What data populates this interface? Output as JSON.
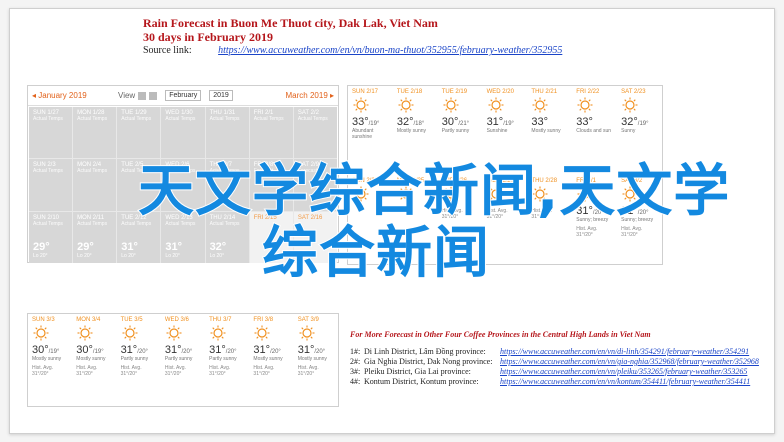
{
  "header": {
    "title": "Rain Forecast in Buon Me Thuot city, Dak Lak, Viet Nam",
    "subtitle": "30 days in February 2019",
    "source_label": "Source link:",
    "source_url": "https://www.accuweather.com/en/vn/buon-ma-thuot/352955/february-weather/352955"
  },
  "calendar_left": {
    "prev_month": "◂ January 2019",
    "view_label": "View",
    "month_select": "February",
    "year_select": "2019",
    "next_month": "March 2019 ▸",
    "days": [
      {
        "name": "SUN 1/27",
        "sub": "Actual Temps",
        "temp": "",
        "lo": ""
      },
      {
        "name": "MON 1/28",
        "sub": "Actual Temps",
        "temp": "",
        "lo": ""
      },
      {
        "name": "TUE 1/29",
        "sub": "Actual Temps",
        "temp": "",
        "lo": ""
      },
      {
        "name": "WED 1/30",
        "sub": "Actual Temps",
        "temp": "",
        "lo": ""
      },
      {
        "name": "THU 1/31",
        "sub": "Actual Temps",
        "temp": "",
        "lo": ""
      },
      {
        "name": "FRI 2/1",
        "sub": "Actual Temps",
        "temp": "",
        "lo": ""
      },
      {
        "name": "SAT 2/2",
        "sub": "Actual Temps",
        "temp": "",
        "lo": ""
      },
      {
        "name": "SUN 2/3",
        "sub": "Actual Temps",
        "temp": "",
        "lo": ""
      },
      {
        "name": "MON 2/4",
        "sub": "Actual Temps",
        "temp": "",
        "lo": ""
      },
      {
        "name": "TUE 2/5",
        "sub": "Actual Temps",
        "temp": "",
        "lo": ""
      },
      {
        "name": "WED 2/6",
        "sub": "Actual Temps",
        "temp": "",
        "lo": ""
      },
      {
        "name": "THU 2/7",
        "sub": "Actual Temps",
        "temp": "",
        "lo": ""
      },
      {
        "name": "FRI 2/8",
        "sub": "Forecast",
        "temp": "",
        "lo": ""
      },
      {
        "name": "SAT 2/9",
        "sub": "Forecast",
        "temp": "",
        "lo": ""
      },
      {
        "name": "SUN 2/10",
        "sub": "Actual Temps",
        "temp": "29°",
        "lo": "Lo 20°"
      },
      {
        "name": "MON 2/11",
        "sub": "Actual Temps",
        "temp": "29°",
        "lo": "Lo 20°"
      },
      {
        "name": "TUE 2/12",
        "sub": "Actual Temps",
        "temp": "31°",
        "lo": "Lo 20°"
      },
      {
        "name": "WED 2/13",
        "sub": "Actual Temps",
        "temp": "31°",
        "lo": "Lo 20°"
      },
      {
        "name": "THU 2/14",
        "sub": "Actual Temps",
        "temp": "32°",
        "lo": "Lo 20°"
      },
      {
        "name": "FRI 2/15",
        "sub": "",
        "temp": "",
        "lo": ""
      },
      {
        "name": "SAT 2/16",
        "sub": "",
        "temp": "",
        "lo": ""
      }
    ]
  },
  "calendar_right": {
    "days": [
      {
        "name": "SUN 2/17",
        "temp": "33°",
        "small": "/19°",
        "desc": "Abundant sunshine",
        "lw": ""
      },
      {
        "name": "TUE 2/18",
        "temp": "32°",
        "small": "/18°",
        "desc": "Mostly sunny",
        "lw": ""
      },
      {
        "name": "TUE 2/19",
        "temp": "30°",
        "small": "/21°",
        "desc": "Partly sunny",
        "lw": ""
      },
      {
        "name": "WED 2/20",
        "temp": "31°",
        "small": "/19°",
        "desc": "Sunshine",
        "lw": ""
      },
      {
        "name": "THU 2/21",
        "temp": "33°",
        "small": "",
        "desc": "Mostly sunny",
        "lw": ""
      },
      {
        "name": "FRI 2/22",
        "temp": "33°",
        "small": "",
        "desc": "Clouds and sun",
        "lw": ""
      },
      {
        "name": "SAT 2/23",
        "temp": "32°",
        "small": "/19°",
        "desc": "Sunny",
        "lw": ""
      },
      {
        "name": "SUN 2/24",
        "temp": "",
        "small": "",
        "desc": "",
        "lw": ""
      },
      {
        "name": "MON 2/25",
        "temp": "",
        "small": "",
        "desc": "",
        "lw": ""
      },
      {
        "name": "TUE 2/26",
        "temp": "",
        "small": "",
        "desc": "",
        "lw": "Hist. Avg. 31°/20°"
      },
      {
        "name": "WED 2/27",
        "temp": "",
        "small": "",
        "desc": "",
        "lw": "Hist. Avg. 31°/20°"
      },
      {
        "name": "THU 2/28",
        "temp": "",
        "small": "",
        "desc": "",
        "lw": "Hist. Avg. 31°/20°"
      },
      {
        "name": "FRI 3/1",
        "temp": "31°",
        "small": "/20°",
        "desc": "Sunny; breezy",
        "lw": "Hist. Avg. 31°/20°"
      },
      {
        "name": "SAT 3/2",
        "temp": "31°",
        "small": "/20°",
        "desc": "Sunny; breezy",
        "lw": "Hist. Avg. 31°/20°"
      }
    ]
  },
  "calendar_bottom": {
    "days": [
      {
        "name": "SUN 3/3",
        "temp": "30°",
        "small": "/19°",
        "desc": "Mostly sunny",
        "lw": "Hist. Avg. 31°/20°"
      },
      {
        "name": "MON 3/4",
        "temp": "30°",
        "small": "/19°",
        "desc": "Mostly sunny",
        "lw": "Hist. Avg. 31°/20°"
      },
      {
        "name": "TUE 3/5",
        "temp": "31°",
        "small": "/20°",
        "desc": "Partly sunny",
        "lw": "Hist. Avg. 31°/20°"
      },
      {
        "name": "WED 3/6",
        "temp": "31°",
        "small": "/20°",
        "desc": "Partly sunny",
        "lw": "Hist. Avg. 31°/20°"
      },
      {
        "name": "THU 3/7",
        "temp": "31°",
        "small": "/20°",
        "desc": "Partly sunny",
        "lw": "Hist. Avg. 31°/20°"
      },
      {
        "name": "FRI 3/8",
        "temp": "31°",
        "small": "/20°",
        "desc": "Mostly sunny",
        "lw": "Hist. Avg. 31°/20°"
      },
      {
        "name": "SAT 3/9",
        "temp": "31°",
        "small": "/20°",
        "desc": "Mostly sunny",
        "lw": "Hist. Avg. 31°/20°"
      }
    ]
  },
  "provinces": {
    "heading": "For More Forecast in Other Four Coffee Provinces in the Central High Lands in Viet Nam",
    "rows": [
      {
        "n": "1#:",
        "name": "Di Linh District, Lâm Đồng province:",
        "url": "https://www.accuweather.com/en/vn/di-linh/354291/february-weather/354291"
      },
      {
        "n": "2#:",
        "name": "Gia Nghia District, Dak Nong province:",
        "url": "https://www.accuweather.com/en/vn/gia-nghia/352968/february-weather/352968"
      },
      {
        "n": "3#:",
        "name": "Pleiku District, Gia Lai province:",
        "url": "https://www.accuweather.com/en/vn/pleiku/353265/february-weather/353265"
      },
      {
        "n": "4#:",
        "name": "Kontum District, Kontum province:",
        "url": "https://www.accuweather.com/en/vn/kontum/354411/february-weather/354411"
      }
    ]
  },
  "watermark": {
    "line1": "天文学综合新闻,天文学",
    "line2": "综合新闻",
    "color": "#1389e0"
  },
  "colors": {
    "accent": "#e2621b",
    "title_red": "#b5161b",
    "link_blue": "#1a44c8",
    "sun_orange": "#f0901f"
  }
}
